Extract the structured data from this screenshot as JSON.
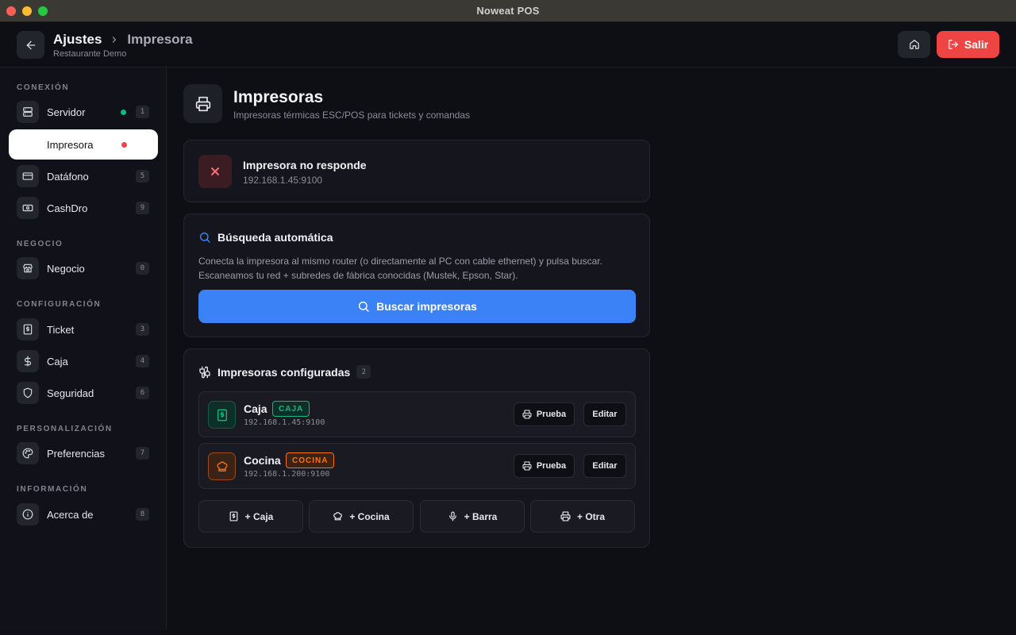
{
  "window": {
    "title": "Noweat POS"
  },
  "header": {
    "breadcrumb_main": "Ajustes",
    "breadcrumb_current": "Impresora",
    "subtitle": "Restaurante Demo",
    "exit_label": "Salir"
  },
  "sidebar": {
    "sections": [
      {
        "title": "CONEXIÓN"
      },
      {
        "title": "NEGOCIO"
      },
      {
        "title": "CONFIGURACIÓN"
      },
      {
        "title": "PERSONALIZACIÓN"
      },
      {
        "title": "INFORMACIÓN"
      }
    ],
    "items": [
      {
        "label": "Servidor",
        "badge": "1",
        "icon": "server-icon",
        "status": "online"
      },
      {
        "label": "Impresora",
        "badge": "",
        "icon": "printer-icon",
        "status": "offline",
        "active": true
      },
      {
        "label": "Datáfono",
        "badge": "5",
        "icon": "credit-card-icon"
      },
      {
        "label": "CashDro",
        "badge": "9",
        "icon": "banknote-icon"
      },
      {
        "label": "Negocio",
        "badge": "0",
        "icon": "store-icon"
      },
      {
        "label": "Ticket",
        "badge": "3",
        "icon": "receipt-icon"
      },
      {
        "label": "Caja",
        "badge": "4",
        "icon": "dollar-icon"
      },
      {
        "label": "Seguridad",
        "badge": "6",
        "icon": "shield-icon"
      },
      {
        "label": "Preferencias",
        "badge": "7",
        "icon": "palette-icon"
      },
      {
        "label": "Acerca de",
        "badge": "8",
        "icon": "info-icon"
      }
    ]
  },
  "page": {
    "title": "Impresoras",
    "subtitle": "Impresoras térmicas ESC/POS para tickets y comandas"
  },
  "status": {
    "title": "Impresora no responde",
    "address": "192.168.1.45:9100"
  },
  "search": {
    "title": "Búsqueda automática",
    "desc_line1": "Conecta la impresora al mismo router (o directamente al PC con cable ethernet) y pulsa buscar.",
    "desc_line2": "Escaneamos tu red + subredes de fábrica conocidas (Mustek, Epson, Star).",
    "button": "Buscar impresoras"
  },
  "configured": {
    "title": "Impresoras configuradas",
    "count": "2",
    "printers": [
      {
        "name": "Caja",
        "tag": "CAJA",
        "address": "192.168.1.45:9100",
        "test_label": "Prueba",
        "edit_label": "Editar",
        "color": "#10b981"
      },
      {
        "name": "Cocina",
        "tag": "COCINA",
        "address": "192.168.1.200:9100",
        "test_label": "Prueba",
        "edit_label": "Editar",
        "color": "#f97316"
      }
    ],
    "add_buttons": [
      {
        "label": "+ Caja",
        "icon": "receipt-icon"
      },
      {
        "label": "+ Cocina",
        "icon": "chef-hat-icon"
      },
      {
        "label": "+ Barra",
        "icon": "microphone-icon"
      },
      {
        "label": "+ Otra",
        "icon": "printer-icon"
      }
    ]
  },
  "colors": {
    "accent": "#3b82f6",
    "danger": "#ef4444",
    "online": "#10b981",
    "offline": "#ef4444"
  }
}
